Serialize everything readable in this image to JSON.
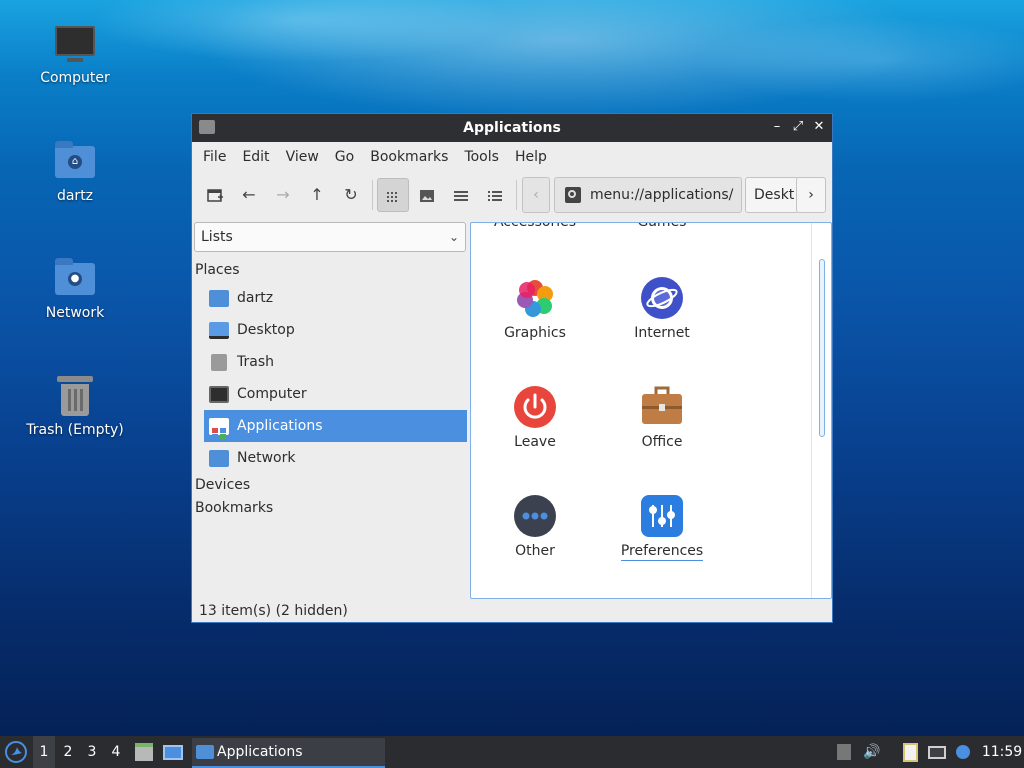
{
  "desktop": {
    "icons": [
      {
        "label": "Computer",
        "icon": "computer-icon"
      },
      {
        "label": "dartz",
        "icon": "home-folder-icon"
      },
      {
        "label": "Network",
        "icon": "network-folder-icon"
      },
      {
        "label": "Trash (Empty)",
        "icon": "trash-icon"
      }
    ]
  },
  "window": {
    "title": "Applications",
    "controls": {
      "minimize": "–",
      "maximize": "⤢",
      "close": "✕"
    },
    "menu": [
      "File",
      "Edit",
      "View",
      "Go",
      "Bookmarks",
      "Tools",
      "Help"
    ],
    "toolbar": {
      "path": "menu://applications/",
      "next_path": "Deskt",
      "back_arrow": "‹",
      "forward_arrow": "›"
    },
    "sidebar": {
      "combo_value": "Lists",
      "places_header": "Places",
      "places": [
        {
          "label": "dartz",
          "icon": "home-folder-icon"
        },
        {
          "label": "Desktop",
          "icon": "desktop-icon"
        },
        {
          "label": "Trash",
          "icon": "trash-icon"
        },
        {
          "label": "Computer",
          "icon": "computer-icon"
        },
        {
          "label": "Applications",
          "icon": "applications-icon",
          "selected": true
        },
        {
          "label": "Network",
          "icon": "network-folder-icon"
        }
      ],
      "devices_header": "Devices",
      "bookmarks_header": "Bookmarks"
    },
    "content": {
      "partial_top": [
        "Accessories",
        "Games"
      ],
      "apps": [
        {
          "label": "Graphics",
          "icon": "graphics-icon"
        },
        {
          "label": "Internet",
          "icon": "internet-icon"
        },
        {
          "label": "Leave",
          "icon": "power-icon"
        },
        {
          "label": "Office",
          "icon": "briefcase-icon"
        },
        {
          "label": "Other",
          "icon": "more-dots-icon"
        },
        {
          "label": "Preferences",
          "icon": "preferences-icon"
        }
      ]
    },
    "status": "13 item(s) (2 hidden)"
  },
  "taskbar": {
    "workspaces": [
      "1",
      "2",
      "3",
      "4"
    ],
    "active_workspace": "1",
    "task_label": "Applications",
    "clock": "11:59"
  },
  "colors": {
    "accent": "#4a8fe0",
    "titlebar": "#2e2f33",
    "taskbar": "#2a2c30"
  }
}
